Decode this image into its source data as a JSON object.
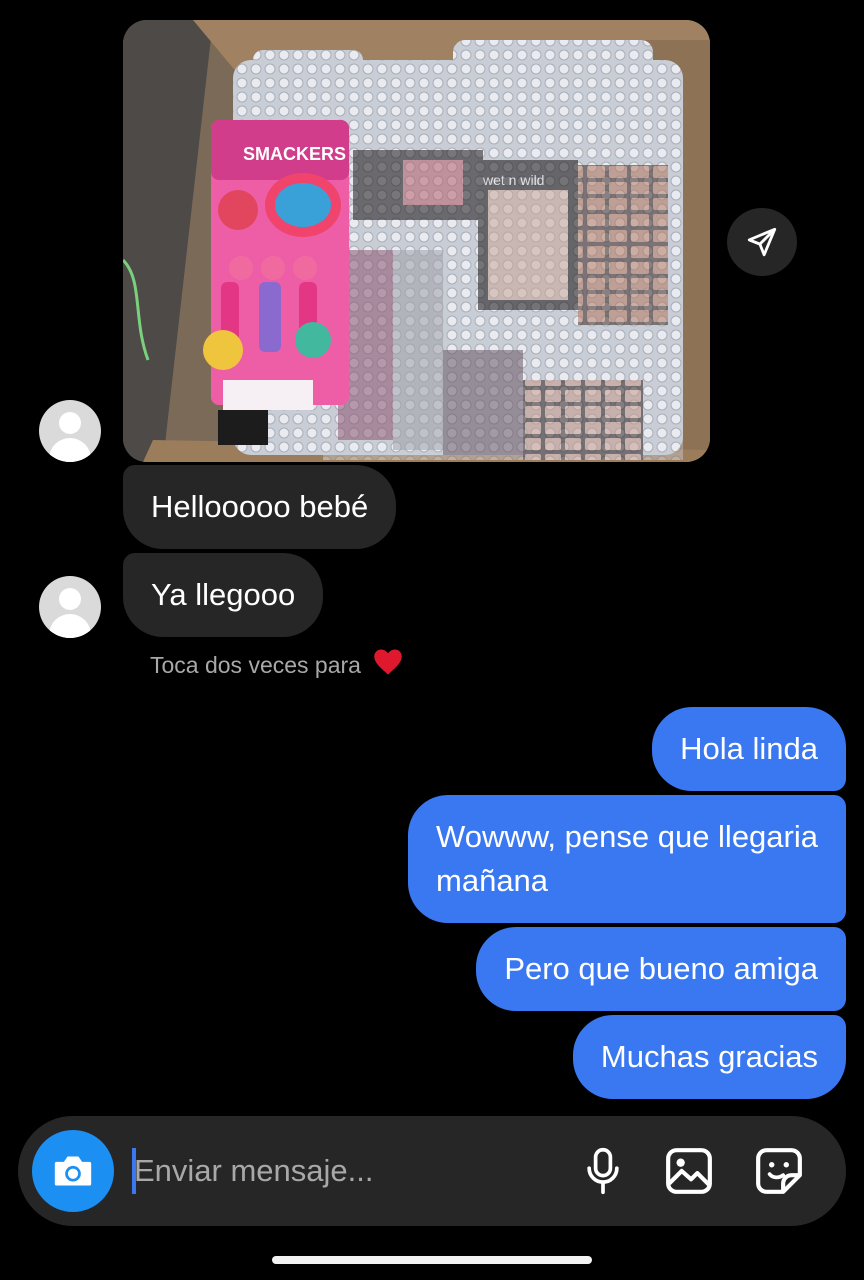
{
  "conversation": {
    "hint_text": "Toca dos veces para",
    "hint_icon": "heart-icon",
    "incoming": [
      {
        "text": "Hellooooo bebé"
      },
      {
        "text": "Ya llegooo"
      }
    ],
    "outgoing": [
      {
        "text": "Hola linda"
      },
      {
        "text": "Wowww, pense que llegaria",
        "text2": "mañana"
      },
      {
        "text": "Pero que bueno amiga"
      },
      {
        "text": "Muchas gracias"
      }
    ],
    "photo_attachment": {
      "package_label": "SMACKERS",
      "brand_label": "wet n wild"
    }
  },
  "composer": {
    "placeholder": "Enviar mensaje...",
    "camera_icon": "camera-icon",
    "tools": [
      "microphone-icon",
      "image-icon",
      "sticker-icon"
    ]
  },
  "colors": {
    "background": "#000000",
    "incoming_bubble": "#262626",
    "outgoing_bubble": "#3a78f2",
    "camera_button": "#1c8ff3",
    "heart": "#e0182d"
  }
}
